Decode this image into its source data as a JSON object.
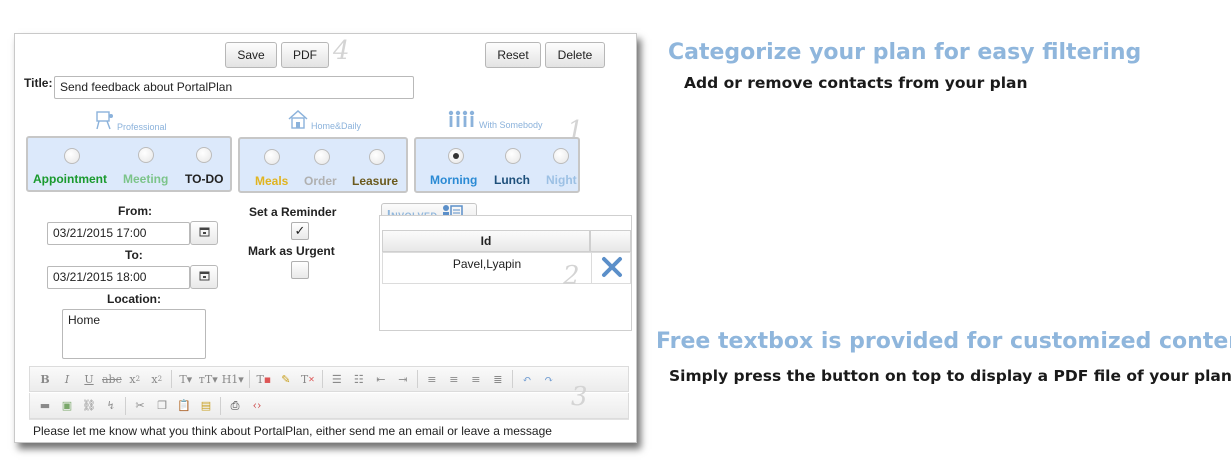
{
  "toolbar": {
    "save": "Save",
    "pdf": "PDF",
    "reset": "Reset",
    "delete": "Delete"
  },
  "steps": {
    "one": "1",
    "two": "2",
    "three": "3",
    "four": "4"
  },
  "title": {
    "label": "Title:",
    "value": "Send feedback about PortalPlan"
  },
  "categories": {
    "professional": {
      "heading": "Professional",
      "icon": "easel-icon",
      "options": [
        {
          "label": "Appointment",
          "color": "#1a9a2e",
          "checked": false
        },
        {
          "label": "Meeting",
          "color": "#7cc48a",
          "checked": false
        },
        {
          "label": "TO-DO",
          "color": "#222222",
          "checked": false
        }
      ]
    },
    "home": {
      "heading": "Home&Daily",
      "icon": "house-icon",
      "options": [
        {
          "label": "Meals",
          "color": "#e0b420",
          "checked": false
        },
        {
          "label": "Order",
          "color": "#b0b0b0",
          "checked": false
        },
        {
          "label": "Leasure",
          "color": "#6b5a1e",
          "checked": false
        }
      ]
    },
    "somebody": {
      "heading": "With Somebody",
      "icon": "people-icon",
      "options": [
        {
          "label": "Morning",
          "color": "#2a8ad4",
          "checked": true
        },
        {
          "label": "Lunch",
          "color": "#1d4f7a",
          "checked": false
        },
        {
          "label": "Night",
          "color": "#9cc0e4",
          "checked": false
        }
      ]
    }
  },
  "schedule": {
    "from_label": "From:",
    "from_value": "03/21/2015 17:00",
    "to_label": "To:",
    "to_value": "03/21/2015 18:00",
    "location_label": "Location:",
    "location_value": "Home"
  },
  "flags": {
    "reminder_label": "Set a Reminder",
    "reminder_checked": true,
    "urgent_label": "Mark as Urgent",
    "urgent_checked": false
  },
  "involved": {
    "tab_label": "Involved",
    "column_id": "Id",
    "rows": [
      "Pavel,Lyapin"
    ]
  },
  "editor": {
    "body_text": "Please let me know what you think about PortalPlan, either send me an email or leave a message"
  },
  "promo": {
    "title1": "Categorize your plan for easy filtering",
    "sub1": "Add or remove contacts from your plan",
    "title2": "Free textbox is provided for customized content",
    "sub2": "Simply press the button on top to display a PDF file of your plan"
  },
  "colors": {
    "accent": "#8fb6dc",
    "category_bg": "#dce9fb",
    "remove_x": "#5b8fc9"
  }
}
